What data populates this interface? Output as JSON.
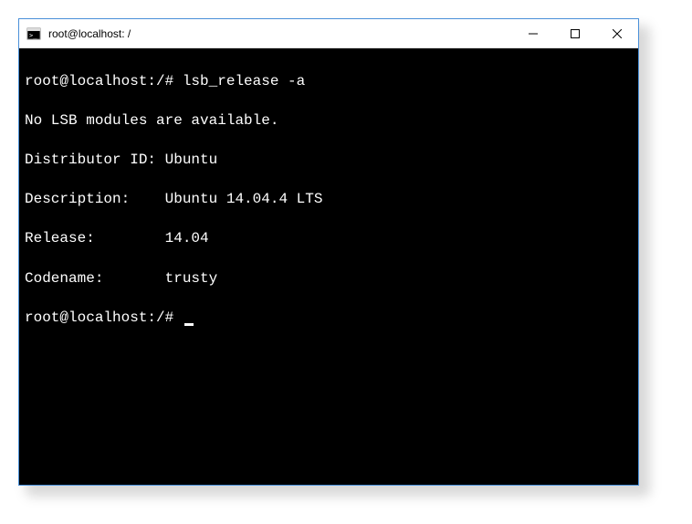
{
  "window": {
    "title": "root@localhost: /"
  },
  "terminal": {
    "prompt": "root@localhost:/#",
    "command": "lsb_release -a",
    "output": {
      "no_modules": "No LSB modules are available.",
      "distributor_label": "Distributor ID:",
      "distributor_value": "Ubuntu",
      "description_label": "Description:",
      "description_value": "Ubuntu 14.04.4 LTS",
      "release_label": "Release:",
      "release_value": "14.04",
      "codename_label": "Codename:",
      "codename_value": "trusty"
    },
    "line1": "root@localhost:/# lsb_release -a",
    "line2": "No LSB modules are available.",
    "line3": "Distributor ID: Ubuntu",
    "line4": "Description:    Ubuntu 14.04.4 LTS",
    "line5": "Release:        14.04",
    "line6": "Codename:       trusty",
    "line7": "root@localhost:/# "
  }
}
